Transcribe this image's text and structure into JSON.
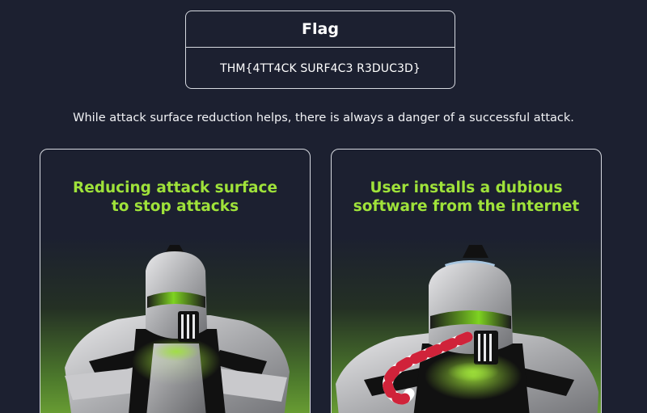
{
  "flag": {
    "title": "Flag",
    "value": "THM{4TT4CK SURF4C3 R3DUC3D}"
  },
  "info": {
    "text": "While attack surface reduction helps, there is always a danger of a successful attack."
  },
  "cards": [
    {
      "heading_line1": "Reducing attack surface",
      "heading_line2": "to stop attacks",
      "image_icon": "knight-icon"
    },
    {
      "heading_line1": "User installs a dubious",
      "heading_line2": "software from the internet",
      "image_icon": "knight-with-candy-cane-icon"
    }
  ],
  "colors": {
    "background": "#1c2030",
    "accent_green": "#9fe23a",
    "border": "#d6d9e0"
  }
}
